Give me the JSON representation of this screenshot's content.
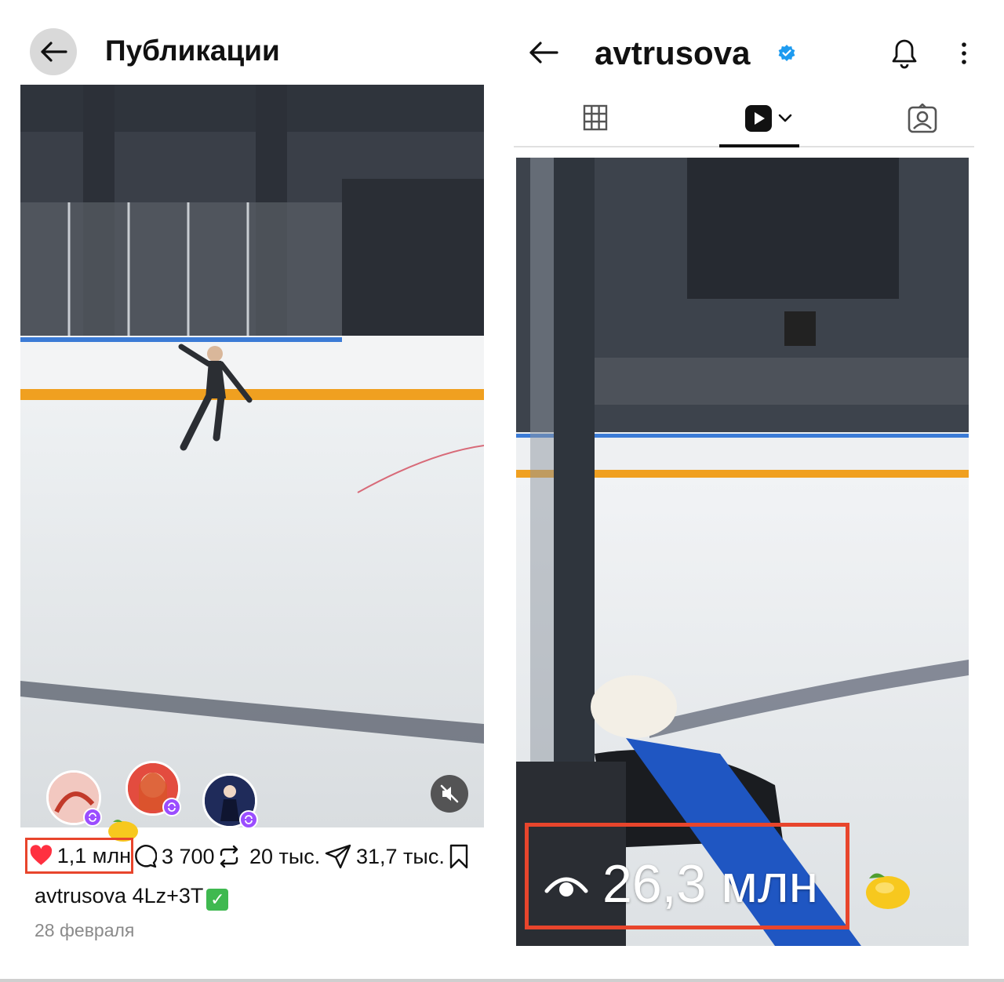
{
  "left_panel": {
    "title": "Публикации",
    "post": {
      "likes": "1,1 млн",
      "comments": "3 700",
      "reposts": "20 тыс.",
      "shares": "31,7 тыс.",
      "username": "avtrusova",
      "caption_text": "4Lz+3T",
      "date": "28 февраля"
    }
  },
  "right_panel": {
    "username": "avtrusova",
    "tabs": [
      "grid-tab",
      "reels-tab",
      "tagged-tab"
    ],
    "views": "26,3 млн"
  },
  "colors": {
    "highlight_red": "#e8452c",
    "verified_blue": "#1d9bf0",
    "heart_red": "#ff3040",
    "badge_purple": "#9b4dff"
  },
  "icons": [
    "back-arrow-icon",
    "verified-badge-icon",
    "bell-icon",
    "more-vertical-icon",
    "grid-icon",
    "reels-icon",
    "chevron-down-icon",
    "tagged-icon",
    "mute-icon",
    "heart-icon",
    "comment-icon",
    "repost-icon",
    "share-icon",
    "bookmark-icon",
    "eye-icon",
    "lemon-icon",
    "check-mark-icon"
  ]
}
